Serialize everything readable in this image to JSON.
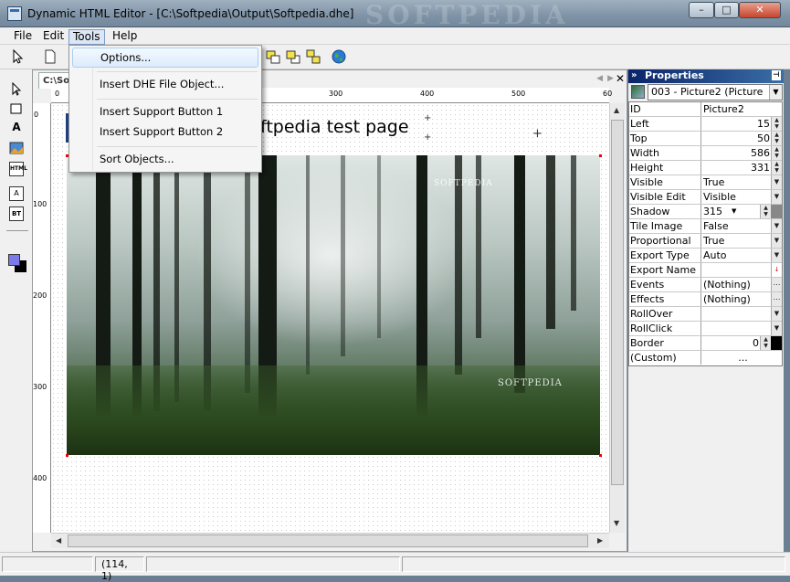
{
  "window": {
    "title": "Dynamic HTML Editor - [C:\\Softpedia\\Output\\Softpedia.dhe]",
    "min": "–",
    "max": "□",
    "close": "✕"
  },
  "menubar": {
    "file": "File",
    "edit": "Edit",
    "tools": "Tools",
    "help": "Help"
  },
  "tools_menu": {
    "items": [
      "Options...",
      "Insert DHE File Object...",
      "Insert Support Button 1",
      "Insert Support Button 2",
      "Sort Objects..."
    ],
    "highlighted": "Options..."
  },
  "left_tools": {
    "text_tool": "A",
    "html_tool": "HTML",
    "label_tool": "A",
    "button_tool": "BT"
  },
  "document": {
    "tab_label": "C:\\So",
    "ruler_h": [
      "0",
      "300",
      "400",
      "500",
      "60"
    ],
    "ruler_v": [
      "0",
      "100",
      "200",
      "300",
      "400"
    ],
    "heading_text": "ftpedia test page",
    "image_watermark_top": "SOFTPEDIA",
    "image_watermark_bottom": "SOFTPEDIA"
  },
  "properties": {
    "title": "Properties",
    "selected_object": "003 - Picture2 (Picture",
    "rows": [
      {
        "name": "ID",
        "value": "Picture2"
      },
      {
        "name": "Left",
        "value": "15"
      },
      {
        "name": "Top",
        "value": "50"
      },
      {
        "name": "Width",
        "value": "586"
      },
      {
        "name": "Height",
        "value": "331"
      },
      {
        "name": "Visible",
        "value": "True"
      },
      {
        "name": "Visible Edit",
        "value": "Visible"
      },
      {
        "name": "Shadow",
        "value": "315"
      },
      {
        "name": "Tile Image",
        "value": "False"
      },
      {
        "name": "Proportional",
        "value": "True"
      },
      {
        "name": "Export Type",
        "value": "Auto"
      },
      {
        "name": "Export Name",
        "value": ""
      },
      {
        "name": "Events",
        "value": "(Nothing)"
      },
      {
        "name": "Effects",
        "value": "(Nothing)"
      },
      {
        "name": "RollOver",
        "value": ""
      },
      {
        "name": "RollClick",
        "value": ""
      },
      {
        "name": "Border",
        "value": "0"
      },
      {
        "name": "(Custom)",
        "value": "..."
      }
    ],
    "shadow_second": "0"
  },
  "statusbar": {
    "coords": "(114, 1)"
  },
  "colors": {
    "accent": "#0a246a",
    "menu_highlight": "#dcebfb",
    "fg_swatch": "#7a7ae8",
    "bg_swatch": "#000000"
  }
}
